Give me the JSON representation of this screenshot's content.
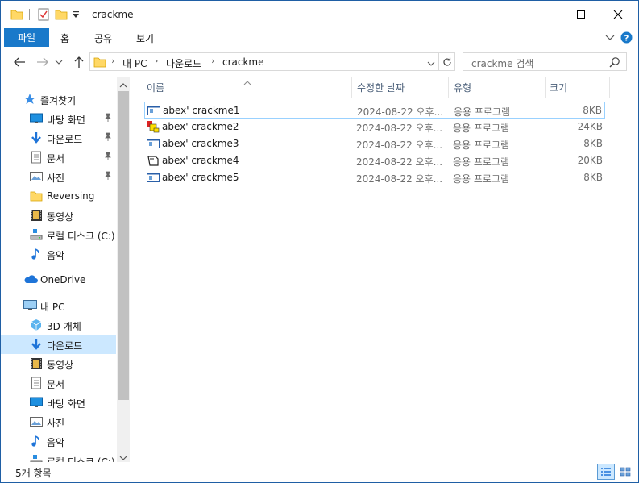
{
  "window": {
    "title": "crackme"
  },
  "titlebar_buttons": {
    "minimize": "—",
    "maximize": "☐",
    "close": "✕"
  },
  "ribbon": {
    "file_tab": "파일",
    "tabs": [
      "홈",
      "공유",
      "보기"
    ]
  },
  "address": {
    "crumbs": [
      "내 PC",
      "다운로드",
      "crackme"
    ]
  },
  "search": {
    "placeholder": "crackme 검색"
  },
  "nav": {
    "quick_access": "즐겨찾기",
    "items": [
      {
        "label": "바탕 화면",
        "icon": "desktop-icon",
        "pinned": true
      },
      {
        "label": "다운로드",
        "icon": "download-icon",
        "pinned": true
      },
      {
        "label": "문서",
        "icon": "document-icon",
        "pinned": true
      },
      {
        "label": "사진",
        "icon": "pictures-icon",
        "pinned": true
      },
      {
        "label": "Reversing",
        "icon": "folder-icon",
        "pinned": false
      },
      {
        "label": "동영상",
        "icon": "video-icon",
        "pinned": false
      },
      {
        "label": "로컬 디스크 (C:)",
        "icon": "drive-icon",
        "pinned": false
      },
      {
        "label": "음악",
        "icon": "music-icon",
        "pinned": false
      }
    ],
    "onedrive": "OneDrive",
    "thispc": "내 PC",
    "pc_items": [
      {
        "label": "3D 개체",
        "icon": "3d-objects-icon"
      },
      {
        "label": "다운로드",
        "icon": "download-icon",
        "selected": true
      },
      {
        "label": "동영상",
        "icon": "video-icon"
      },
      {
        "label": "문서",
        "icon": "document-icon"
      },
      {
        "label": "바탕 화면",
        "icon": "desktop-icon"
      },
      {
        "label": "사진",
        "icon": "pictures-icon"
      },
      {
        "label": "음악",
        "icon": "music-icon"
      },
      {
        "label": "로컬 디스크 (C:)",
        "icon": "drive-icon"
      }
    ]
  },
  "columns": {
    "name": "이름",
    "modified": "수정한 날짜",
    "type": "유형",
    "size": "크기"
  },
  "files": [
    {
      "name": "abex' crackme1",
      "modified": "2024-08-22 오후...",
      "type": "응용 프로그램",
      "size": "8KB",
      "icon": "app-window-icon",
      "selected": true
    },
    {
      "name": "abex' crackme2",
      "modified": "2024-08-22 오후...",
      "type": "응용 프로그램",
      "size": "24KB",
      "icon": "vb-app-icon"
    },
    {
      "name": "abex' crackme3",
      "modified": "2024-08-22 오후...",
      "type": "응용 프로그램",
      "size": "8KB",
      "icon": "app-window-icon"
    },
    {
      "name": "abex' crackme4",
      "modified": "2024-08-22 오후...",
      "type": "응용 프로그램",
      "size": "20KB",
      "icon": "custom-app-icon"
    },
    {
      "name": "abex' crackme5",
      "modified": "2024-08-22 오후...",
      "type": "응용 프로그램",
      "size": "8KB",
      "icon": "app-window-icon"
    }
  ],
  "status": {
    "item_count": "5개 항목"
  },
  "colors": {
    "accent": "#1979ca",
    "selection": "#cce8ff",
    "folder": "#ffd866"
  }
}
